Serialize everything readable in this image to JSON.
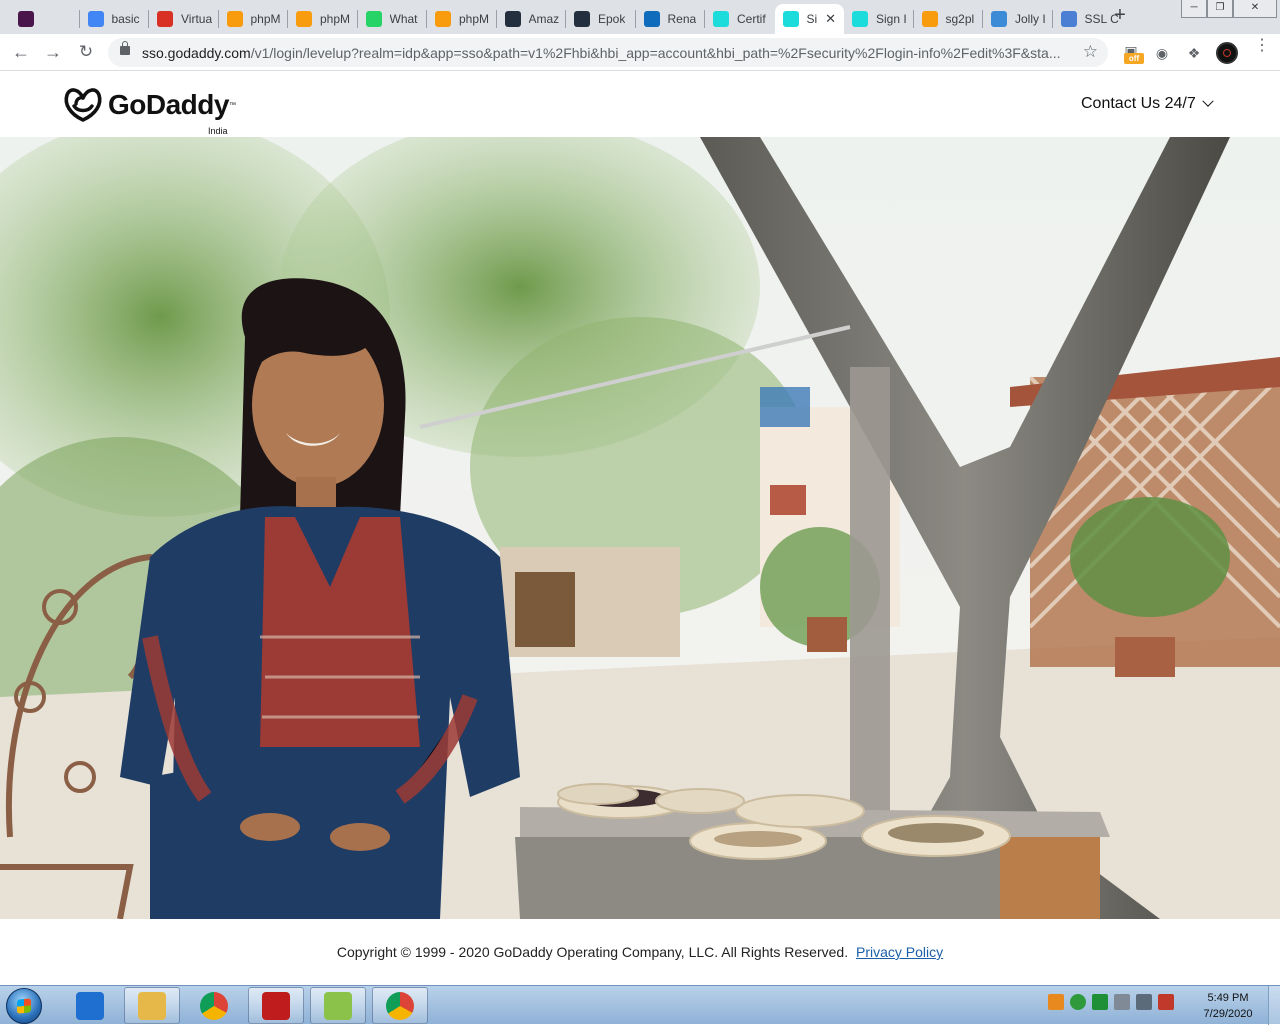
{
  "browser": {
    "tabs": [
      {
        "title": "",
        "favicon": "slack-icon",
        "color": "#4a154b"
      },
      {
        "title": "basic",
        "favicon": "google-icon",
        "color": "#4285f4"
      },
      {
        "title": "Virtua",
        "favicon": "gmail-icon",
        "color": "#d93025"
      },
      {
        "title": "phpM",
        "favicon": "phpmyadmin-icon",
        "color": "#f89c0e"
      },
      {
        "title": "phpM",
        "favicon": "phpmyadmin-icon",
        "color": "#f89c0e"
      },
      {
        "title": "What",
        "favicon": "whatsapp-icon",
        "color": "#25d366"
      },
      {
        "title": "phpM",
        "favicon": "phpmyadmin-icon",
        "color": "#f89c0e"
      },
      {
        "title": "Amaz",
        "favicon": "amazon-icon",
        "color": "#232f3e"
      },
      {
        "title": "Epok",
        "favicon": "amazon-icon",
        "color": "#232f3e"
      },
      {
        "title": "Rena",
        "favicon": "outlook-icon",
        "color": "#0f6cbd"
      },
      {
        "title": "Certif",
        "favicon": "godaddy-icon",
        "color": "#1bdbdb"
      },
      {
        "title": "Si",
        "favicon": "godaddy-icon",
        "color": "#1bdbdb",
        "active": true
      },
      {
        "title": "Sign I",
        "favicon": "godaddy-icon",
        "color": "#1bdbdb"
      },
      {
        "title": "sg2pl",
        "favicon": "phpmyadmin-icon",
        "color": "#f89c0e"
      },
      {
        "title": "Jolly I",
        "favicon": "globe-icon",
        "color": "#3b8bd6"
      },
      {
        "title": "SSL C",
        "favicon": "shield-icon",
        "color": "#4a7fd4"
      }
    ],
    "url_domain": "sso.godaddy.com",
    "url_path": "/v1/login/levelup?realm=idp&app=sso&path=v1%2Fhbi&hbi_app=account&hbi_path=%2Fsecurity%2Flogin-info%2Fedit%3F&sta...",
    "ext_badge": "off"
  },
  "header": {
    "logo_text": "GoDaddy",
    "country": "India",
    "contact_label": "Contact Us 24/7"
  },
  "footer": {
    "copyright": "Copyright © 1999 - 2020 GoDaddy Operating Company, LLC. All Rights Reserved.",
    "privacy_label": "Privacy Policy"
  },
  "taskbar": {
    "time": "5:49 PM",
    "date": "7/29/2020",
    "apps": [
      {
        "name": "internet-explorer-icon",
        "color": "#1e6fd0",
        "open": false
      },
      {
        "name": "file-explorer-icon",
        "color": "#e6b84a",
        "open": true
      },
      {
        "name": "chrome-icon",
        "color": "#34a853",
        "open": false
      },
      {
        "name": "filezilla-icon",
        "color": "#bf1d1d",
        "open": true
      },
      {
        "name": "notepad-plus-plus-icon",
        "color": "#8bc34a",
        "open": true
      },
      {
        "name": "chrome-profile-icon",
        "color": "#db4437",
        "open": true
      }
    ]
  }
}
